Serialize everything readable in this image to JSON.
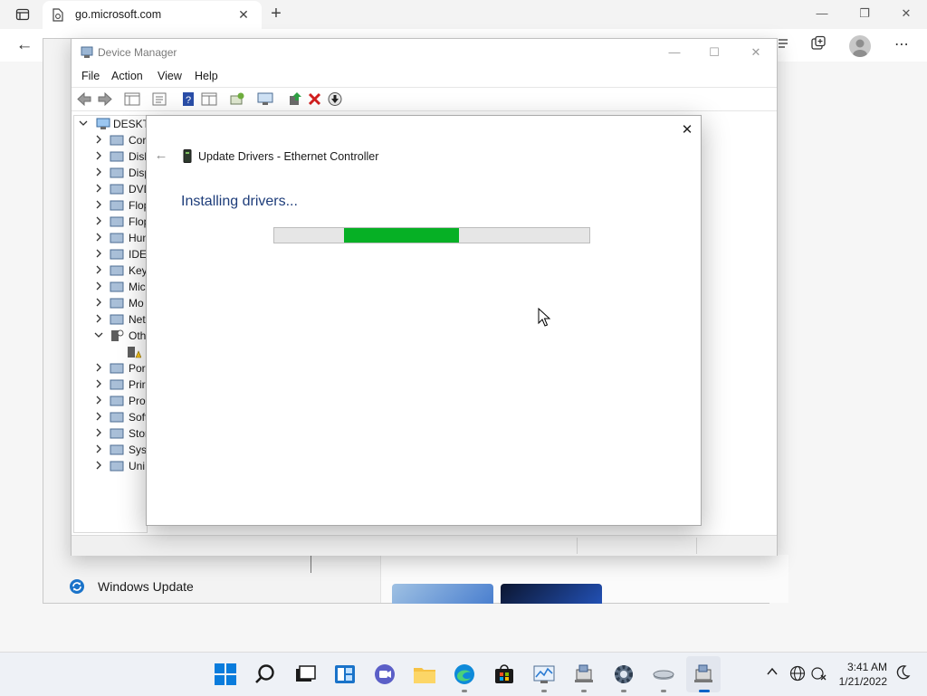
{
  "browser": {
    "tab_title": "go.microsoft.com",
    "tab_close": "✕",
    "new_tab": "+",
    "back": "←",
    "window_controls": {
      "minimize": "—",
      "restore": "❐",
      "close": "✕"
    }
  },
  "settings": {
    "windows_update_label": "Windows Update"
  },
  "device_manager": {
    "title": "Device Manager",
    "window_controls": {
      "minimize": "—",
      "maximize": "☐",
      "close": "✕"
    },
    "menu": [
      "File",
      "Action",
      "View",
      "Help"
    ],
    "tree": {
      "root": "DESKTC",
      "items": [
        {
          "label": "Cor",
          "icon": "computer-icon",
          "expanded": false
        },
        {
          "label": "Disk",
          "icon": "disk-drive-icon",
          "expanded": false
        },
        {
          "label": "Disp",
          "icon": "display-adapter-icon",
          "expanded": false
        },
        {
          "label": "DVD",
          "icon": "dvd-drive-icon",
          "expanded": false
        },
        {
          "label": "Flop",
          "icon": "floppy-controller-icon",
          "expanded": false
        },
        {
          "label": "Flop",
          "icon": "floppy-drive-icon",
          "expanded": false
        },
        {
          "label": "Hun",
          "icon": "hid-icon",
          "expanded": false
        },
        {
          "label": "IDE",
          "icon": "ide-controller-icon",
          "expanded": false
        },
        {
          "label": "Key",
          "icon": "keyboard-icon",
          "expanded": false
        },
        {
          "label": "Mic",
          "icon": "mouse-icon",
          "expanded": false
        },
        {
          "label": "Mo",
          "icon": "monitor-icon",
          "expanded": false
        },
        {
          "label": "Net",
          "icon": "network-adapter-icon",
          "expanded": false
        },
        {
          "label": "Oth",
          "icon": "other-devices-icon",
          "expanded": true
        },
        {
          "label": "",
          "icon": "unknown-device-warning-icon",
          "child": true
        },
        {
          "label": "Por",
          "icon": "ports-icon",
          "expanded": false
        },
        {
          "label": "Prir",
          "icon": "printer-icon",
          "expanded": false
        },
        {
          "label": "Pro",
          "icon": "processor-icon",
          "expanded": false
        },
        {
          "label": "Soft",
          "icon": "software-device-icon",
          "expanded": false
        },
        {
          "label": "Stor",
          "icon": "storage-controller-icon",
          "expanded": false
        },
        {
          "label": "Syst",
          "icon": "system-devices-icon",
          "expanded": false
        },
        {
          "label": "Uni",
          "icon": "usb-controller-icon",
          "expanded": false
        }
      ]
    }
  },
  "dialog": {
    "title": "Update Drivers - Ethernet Controller",
    "heading": "Installing drivers...",
    "close": "✕",
    "back": "←",
    "progress": {
      "indeterminate": true,
      "segment_start": 0.22,
      "segment_end": 0.585
    }
  },
  "taskbar": {
    "time": "3:41 AM",
    "date": "1/21/2022",
    "chevron": "^"
  },
  "colors": {
    "progress_fill": "#06b025",
    "dialog_heading": "#1e3d7a",
    "windows_blue": "#0078d4"
  }
}
